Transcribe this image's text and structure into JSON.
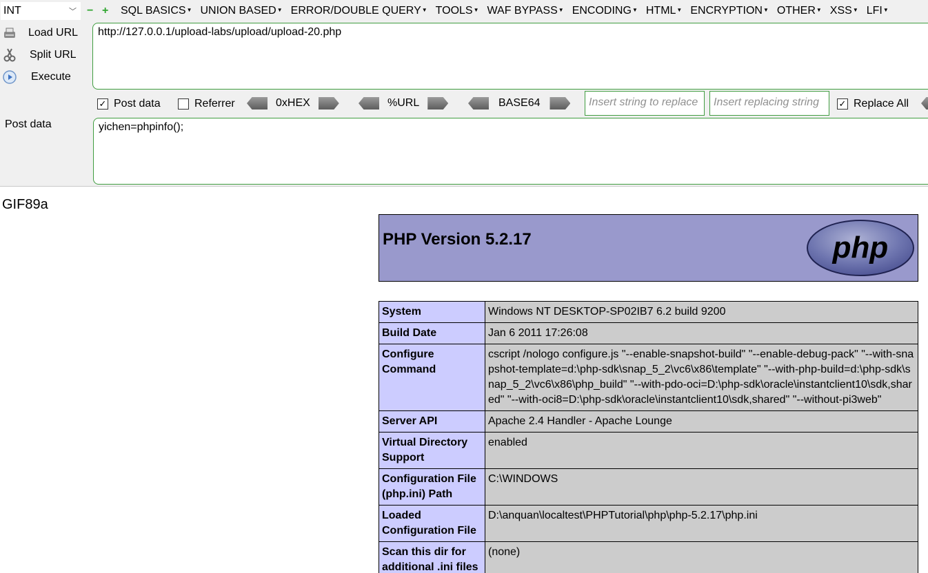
{
  "toolbar": {
    "type_select": "INT",
    "minus": "−",
    "plus": "+",
    "menus": [
      "SQL BASICS",
      "UNION BASED",
      "ERROR/DOUBLE QUERY",
      "TOOLS",
      "WAF BYPASS",
      "ENCODING",
      "HTML",
      "ENCRYPTION",
      "OTHER",
      "XSS",
      "LFI"
    ],
    "load_url": "Load URL",
    "split_url": "Split URL",
    "execute": "Execute",
    "url_value": "http://127.0.0.1/upload-labs/upload/upload-20.php",
    "post_data_checkbox": "Post data",
    "referrer_checkbox": "Referrer",
    "hex": "0xHEX",
    "url_enc": "%URL",
    "base64": "BASE64",
    "replace_placeholder": "Insert string to replace",
    "replacing_placeholder": "Insert replacing string",
    "replace_all": "Replace All",
    "post_data_label": "Post data",
    "post_data_value": "yichen=phpinfo();"
  },
  "page": {
    "gif_header": "GIF89a",
    "php_version": "PHP Version 5.2.17",
    "logo_text": "php",
    "rows": [
      {
        "key": "System",
        "value": "Windows NT DESKTOP-SP02IB7 6.2 build 9200"
      },
      {
        "key": "Build Date",
        "value": "Jan 6 2011 17:26:08"
      },
      {
        "key": "Configure Command",
        "value": "cscript /nologo configure.js \"--enable-snapshot-build\" \"--enable-debug-pack\" \"--with-snapshot-template=d:\\php-sdk\\snap_5_2\\vc6\\x86\\template\" \"--with-php-build=d:\\php-sdk\\snap_5_2\\vc6\\x86\\php_build\" \"--with-pdo-oci=D:\\php-sdk\\oracle\\instantclient10\\sdk,shared\" \"--with-oci8=D:\\php-sdk\\oracle\\instantclient10\\sdk,shared\" \"--without-pi3web\""
      },
      {
        "key": "Server API",
        "value": "Apache 2.4 Handler - Apache Lounge"
      },
      {
        "key": "Virtual Directory Support",
        "value": "enabled"
      },
      {
        "key": "Configuration File (php.ini) Path",
        "value": "C:\\WINDOWS"
      },
      {
        "key": "Loaded Configuration File",
        "value": "D:\\anquan\\localtest\\PHPTutorial\\php\\php-5.2.17\\php.ini"
      },
      {
        "key": "Scan this dir for additional .ini files",
        "value": "(none)"
      }
    ]
  },
  "colors": {
    "header_bg": "#9999cc",
    "key_bg": "#ccccff",
    "value_bg": "#cccccc",
    "field_border": "#3f9c3f"
  }
}
